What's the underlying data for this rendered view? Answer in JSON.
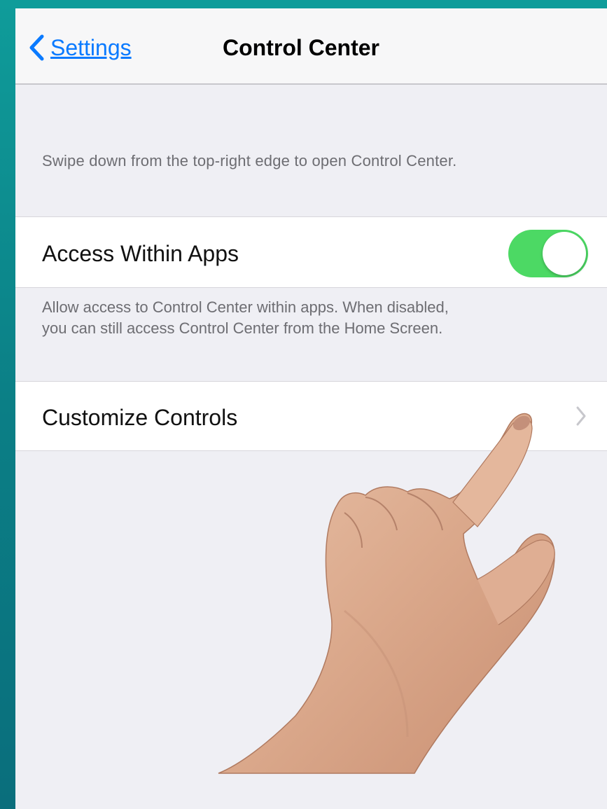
{
  "nav": {
    "back_label": "Settings",
    "title": "Control Center"
  },
  "header_text": "Swipe down from the top-right edge to open Control Center.",
  "access_within_apps": {
    "label": "Access Within Apps",
    "enabled": true
  },
  "footer_text": {
    "line1": "Allow access to Control Center within apps. When disabled,",
    "line2": "you can still access Control Center from the Home Screen."
  },
  "customize_controls": {
    "label": "Customize Controls"
  },
  "colors": {
    "accent": "#0a7aff",
    "toggle_on": "#4cd964",
    "background": "#efeff4",
    "frame": "#0b8a8e"
  },
  "icons": {
    "back": "chevron-left-icon",
    "disclosure": "chevron-right-icon",
    "pointer": "pointing-hand-icon"
  }
}
